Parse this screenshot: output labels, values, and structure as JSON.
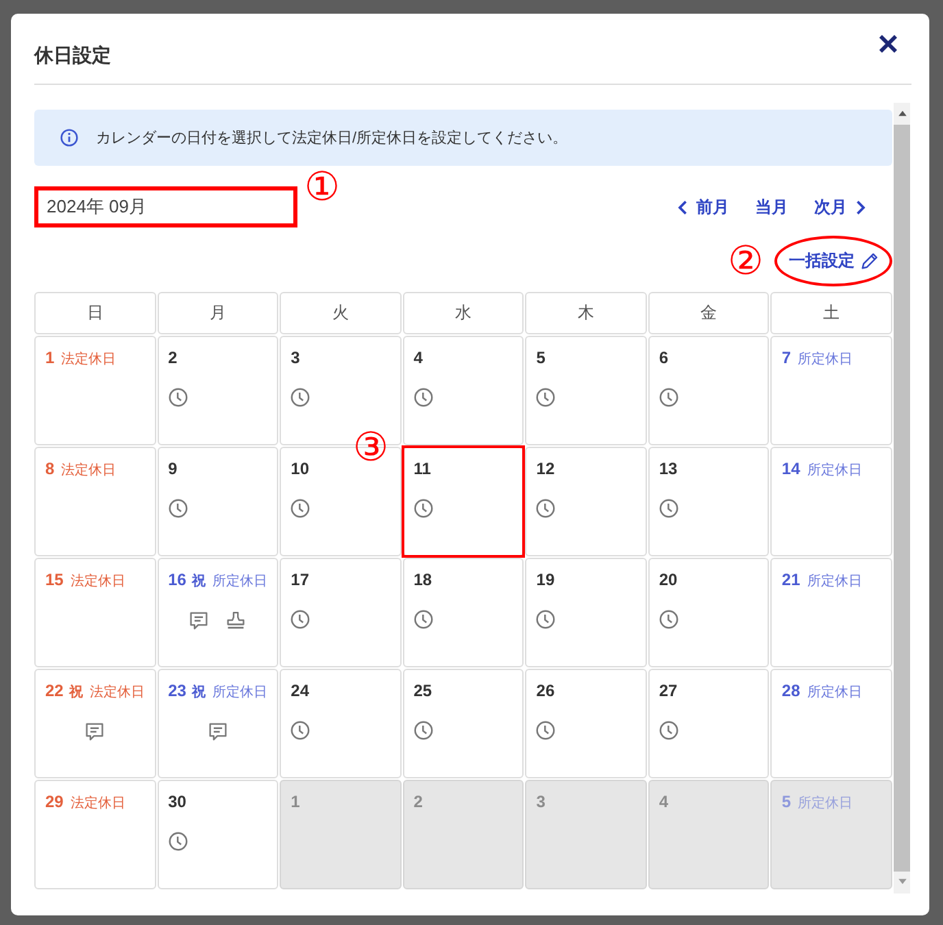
{
  "dialog": {
    "title": "休日設定"
  },
  "info": {
    "text": "カレンダーの日付を選択して法定休日/所定休日を設定してください。"
  },
  "month_field": {
    "value": "2024年 09月",
    "annotation": "①"
  },
  "nav": [
    {
      "label": "前月",
      "kind": "prev"
    },
    {
      "label": "当月",
      "kind": "current"
    },
    {
      "label": "次月",
      "kind": "next"
    }
  ],
  "bulk_button": {
    "label": "一括設定",
    "annotation": "②"
  },
  "calendar": {
    "weekdays": [
      "日",
      "月",
      "火",
      "水",
      "木",
      "金",
      "土"
    ],
    "cells": [
      {
        "day": "1",
        "kind": "legal",
        "holiday_label": "法定休日",
        "in_month": true,
        "attendance": false,
        "note": false,
        "seal": false
      },
      {
        "day": "2",
        "kind": "workday",
        "in_month": true,
        "attendance": true,
        "note": false,
        "seal": false
      },
      {
        "day": "3",
        "kind": "workday",
        "in_month": true,
        "attendance": true,
        "note": false,
        "seal": false
      },
      {
        "day": "4",
        "kind": "workday",
        "in_month": true,
        "attendance": true,
        "note": false,
        "seal": false
      },
      {
        "day": "5",
        "kind": "workday",
        "in_month": true,
        "attendance": true,
        "note": false,
        "seal": false
      },
      {
        "day": "6",
        "kind": "workday",
        "in_month": true,
        "attendance": true,
        "note": false,
        "seal": false
      },
      {
        "day": "7",
        "kind": "scheduled",
        "holiday_label": "所定休日",
        "in_month": true,
        "attendance": false,
        "note": false,
        "seal": false
      },
      {
        "day": "8",
        "kind": "legal",
        "holiday_label": "法定休日",
        "in_month": true,
        "attendance": false,
        "note": false,
        "seal": false
      },
      {
        "day": "9",
        "kind": "workday",
        "in_month": true,
        "attendance": true,
        "note": false,
        "seal": false
      },
      {
        "day": "10",
        "kind": "workday",
        "in_month": true,
        "attendance": true,
        "note": false,
        "seal": false
      },
      {
        "day": "11",
        "kind": "workday",
        "in_month": true,
        "attendance": true,
        "note": false,
        "seal": false,
        "annotation": "③"
      },
      {
        "day": "12",
        "kind": "workday",
        "in_month": true,
        "attendance": true,
        "note": false,
        "seal": false
      },
      {
        "day": "13",
        "kind": "workday",
        "in_month": true,
        "attendance": true,
        "note": false,
        "seal": false
      },
      {
        "day": "14",
        "kind": "scheduled",
        "holiday_label": "所定休日",
        "in_month": true,
        "attendance": false,
        "note": false,
        "seal": false
      },
      {
        "day": "15",
        "kind": "legal",
        "holiday_label": "法定休日",
        "in_month": true,
        "attendance": false,
        "note": false,
        "seal": false
      },
      {
        "day": "16",
        "kind": "scheduled",
        "holiday_mark": "祝",
        "holiday_label": "所定休日",
        "in_month": true,
        "attendance": false,
        "note": true,
        "seal": true
      },
      {
        "day": "17",
        "kind": "workday",
        "in_month": true,
        "attendance": true,
        "note": false,
        "seal": false
      },
      {
        "day": "18",
        "kind": "workday",
        "in_month": true,
        "attendance": true,
        "note": false,
        "seal": false
      },
      {
        "day": "19",
        "kind": "workday",
        "in_month": true,
        "attendance": true,
        "note": false,
        "seal": false
      },
      {
        "day": "20",
        "kind": "workday",
        "in_month": true,
        "attendance": true,
        "note": false,
        "seal": false
      },
      {
        "day": "21",
        "kind": "scheduled",
        "holiday_label": "所定休日",
        "in_month": true,
        "attendance": false,
        "note": false,
        "seal": false
      },
      {
        "day": "22",
        "kind": "legal",
        "holiday_mark": "祝",
        "holiday_label": "法定休日",
        "in_month": true,
        "attendance": false,
        "note": true,
        "seal": false
      },
      {
        "day": "23",
        "kind": "scheduled",
        "holiday_mark": "祝",
        "holiday_label": "所定休日",
        "in_month": true,
        "attendance": false,
        "note": true,
        "seal": false
      },
      {
        "day": "24",
        "kind": "workday",
        "in_month": true,
        "attendance": true,
        "note": false,
        "seal": false
      },
      {
        "day": "25",
        "kind": "workday",
        "in_month": true,
        "attendance": true,
        "note": false,
        "seal": false
      },
      {
        "day": "26",
        "kind": "workday",
        "in_month": true,
        "attendance": true,
        "note": false,
        "seal": false
      },
      {
        "day": "27",
        "kind": "workday",
        "in_month": true,
        "attendance": true,
        "note": false,
        "seal": false
      },
      {
        "day": "28",
        "kind": "scheduled",
        "holiday_label": "所定休日",
        "in_month": true,
        "attendance": false,
        "note": false,
        "seal": false
      },
      {
        "day": "29",
        "kind": "legal",
        "holiday_label": "法定休日",
        "in_month": true,
        "attendance": false,
        "note": false,
        "seal": false
      },
      {
        "day": "30",
        "kind": "workday",
        "in_month": true,
        "attendance": true,
        "note": false,
        "seal": false
      },
      {
        "day": "1",
        "kind": "workday",
        "in_month": false,
        "attendance": false,
        "note": false,
        "seal": false
      },
      {
        "day": "2",
        "kind": "workday",
        "in_month": false,
        "attendance": false,
        "note": false,
        "seal": false
      },
      {
        "day": "3",
        "kind": "workday",
        "in_month": false,
        "attendance": false,
        "note": false,
        "seal": false
      },
      {
        "day": "4",
        "kind": "workday",
        "in_month": false,
        "attendance": false,
        "note": false,
        "seal": false
      },
      {
        "day": "5",
        "kind": "scheduled",
        "holiday_label": "所定休日",
        "in_month": false,
        "attendance": false,
        "note": false,
        "seal": false
      }
    ]
  }
}
